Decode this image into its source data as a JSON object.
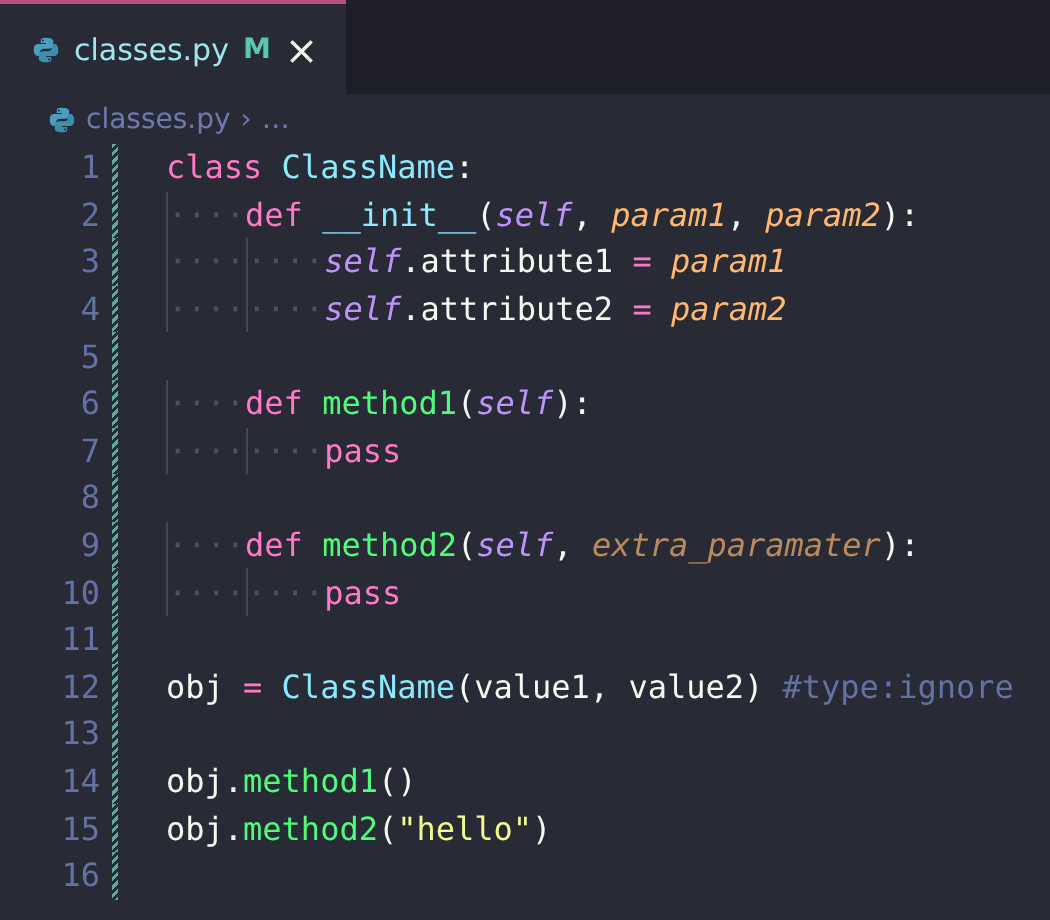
{
  "tabs": [
    {
      "label": "classes.py",
      "status": "M",
      "close": "×",
      "selected": true
    }
  ],
  "breadcrumb": {
    "file": "classes.py",
    "separator": "›",
    "more": "…"
  },
  "editor": {
    "lines": [
      {
        "number": "1",
        "tokens": [
          {
            "kind": "keyword",
            "text": "class "
          },
          {
            "kind": "class",
            "text": "ClassName"
          },
          {
            "kind": "plain",
            "text": ":"
          }
        ]
      },
      {
        "number": "2",
        "indent": [
          "····"
        ],
        "tokens": [
          {
            "kind": "keyword",
            "text": "def "
          },
          {
            "kind": "class",
            "text": "__init__"
          },
          {
            "kind": "plain",
            "text": "("
          },
          {
            "kind": "self",
            "text": "self"
          },
          {
            "kind": "plain",
            "text": ", "
          },
          {
            "kind": "param",
            "text": "param1"
          },
          {
            "kind": "plain",
            "text": ", "
          },
          {
            "kind": "param",
            "text": "param2"
          },
          {
            "kind": "plain",
            "text": "):"
          }
        ]
      },
      {
        "number": "3",
        "indent": [
          "····",
          "····"
        ],
        "tokens": [
          {
            "kind": "self",
            "text": "self"
          },
          {
            "kind": "plain",
            "text": ".attribute1 "
          },
          {
            "kind": "operator",
            "text": "= "
          },
          {
            "kind": "param",
            "text": "param1"
          }
        ]
      },
      {
        "number": "4",
        "indent": [
          "····",
          "····"
        ],
        "tokens": [
          {
            "kind": "self",
            "text": "self"
          },
          {
            "kind": "plain",
            "text": ".attribute2 "
          },
          {
            "kind": "operator",
            "text": "= "
          },
          {
            "kind": "param",
            "text": "param2"
          }
        ]
      },
      {
        "number": "5"
      },
      {
        "number": "6",
        "indent": [
          "····"
        ],
        "tokens": [
          {
            "kind": "keyword",
            "text": "def "
          },
          {
            "kind": "function",
            "text": "method1"
          },
          {
            "kind": "plain",
            "text": "("
          },
          {
            "kind": "self",
            "text": "self"
          },
          {
            "kind": "plain",
            "text": "):"
          }
        ]
      },
      {
        "number": "7",
        "indent": [
          "····",
          "····"
        ],
        "tokens": [
          {
            "kind": "keyword",
            "text": "pass"
          }
        ]
      },
      {
        "number": "8"
      },
      {
        "number": "9",
        "indent": [
          "····"
        ],
        "tokens": [
          {
            "kind": "keyword",
            "text": "def "
          },
          {
            "kind": "function",
            "text": "method2"
          },
          {
            "kind": "plain",
            "text": "("
          },
          {
            "kind": "self",
            "text": "self"
          },
          {
            "kind": "plain",
            "text": ", "
          },
          {
            "kind": "unused",
            "text": "extra_paramater"
          },
          {
            "kind": "plain",
            "text": "):"
          }
        ]
      },
      {
        "number": "10",
        "indent": [
          "····",
          "····"
        ],
        "tokens": [
          {
            "kind": "keyword",
            "text": "pass"
          }
        ]
      },
      {
        "number": "11"
      },
      {
        "number": "12",
        "tokens": [
          {
            "kind": "plain",
            "text": "obj "
          },
          {
            "kind": "operator",
            "text": "= "
          },
          {
            "kind": "class",
            "text": "ClassName"
          },
          {
            "kind": "plain",
            "text": "(value1, value2) "
          },
          {
            "kind": "comment",
            "text": "#type:ignore"
          }
        ]
      },
      {
        "number": "13"
      },
      {
        "number": "14",
        "tokens": [
          {
            "kind": "plain",
            "text": "obj."
          },
          {
            "kind": "function",
            "text": "method1"
          },
          {
            "kind": "plain",
            "text": "()"
          }
        ]
      },
      {
        "number": "15",
        "tokens": [
          {
            "kind": "plain",
            "text": "obj."
          },
          {
            "kind": "function",
            "text": "method2"
          },
          {
            "kind": "plain",
            "text": "("
          },
          {
            "kind": "string",
            "text": "\"hello\""
          },
          {
            "kind": "plain",
            "text": ")"
          }
        ]
      },
      {
        "number": "16"
      }
    ]
  }
}
